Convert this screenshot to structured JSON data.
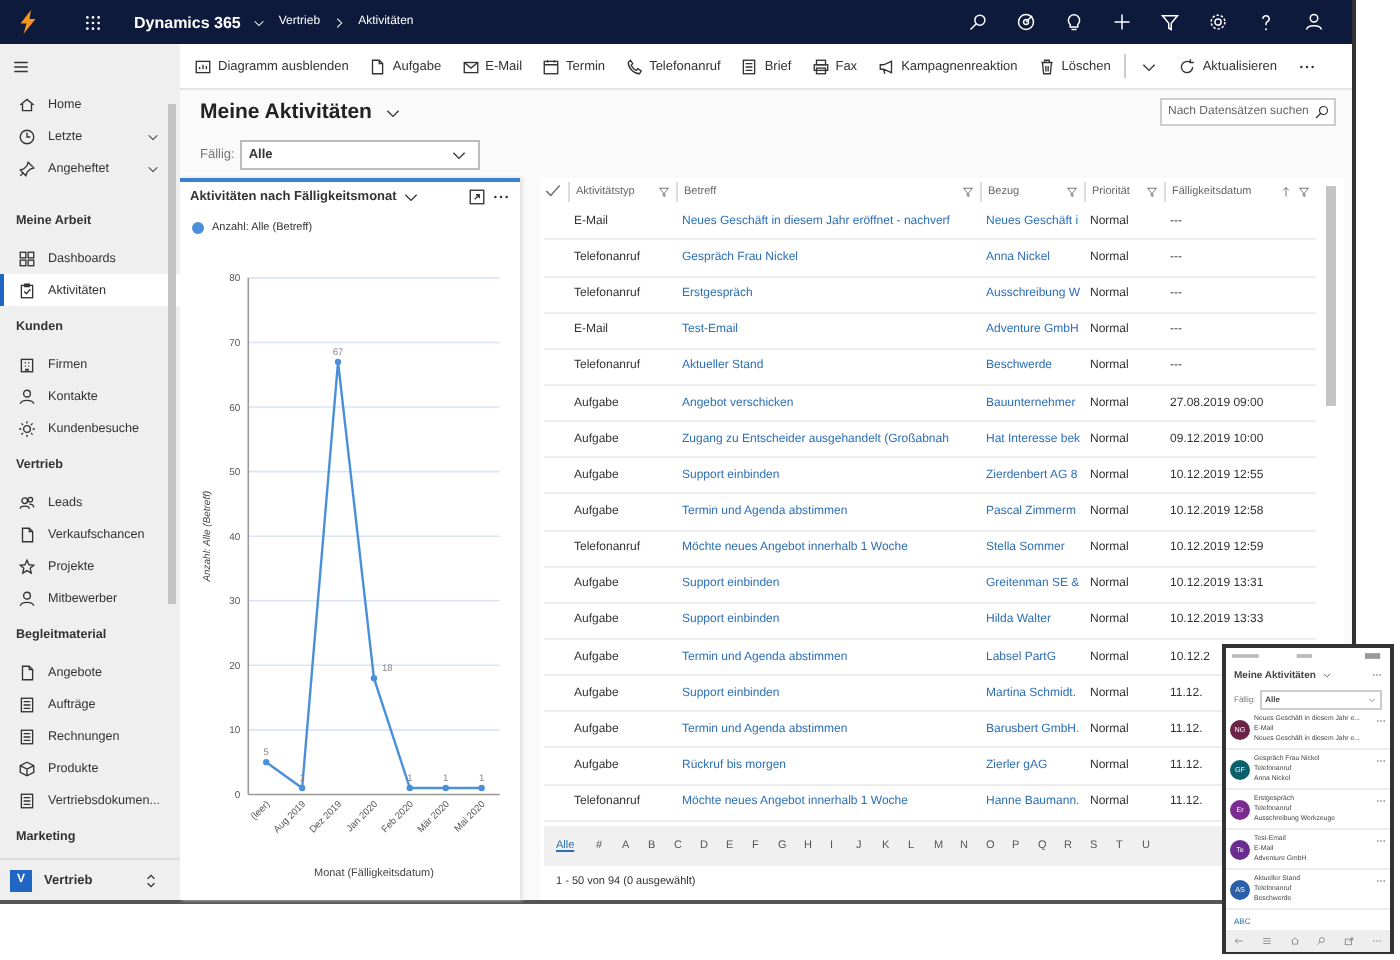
{
  "top_bar": {
    "app_name": "Dynamics 365",
    "breadcrumb": [
      "Vertrieb",
      "Aktivitäten"
    ]
  },
  "sidebar": {
    "items": [
      {
        "label": "Home",
        "selected": false
      },
      {
        "label": "Letzte",
        "selected": false,
        "expanded": false
      },
      {
        "label": "Angeheftet",
        "selected": false,
        "expanded": false
      }
    ],
    "sections": [
      {
        "title": "Meine Arbeit",
        "items": [
          {
            "label": "Dashboards",
            "selected": false
          },
          {
            "label": "Aktivitäten",
            "selected": true
          }
        ]
      },
      {
        "title": "Kunden",
        "items": [
          {
            "label": "Firmen",
            "selected": false
          },
          {
            "label": "Kontakte",
            "selected": false
          },
          {
            "label": "Kundenbesuche",
            "selected": false
          }
        ]
      },
      {
        "title": "Vertrieb",
        "items": [
          {
            "label": "Leads",
            "selected": false
          },
          {
            "label": "Verkaufschancen",
            "selected": false
          },
          {
            "label": "Projekte",
            "selected": false
          },
          {
            "label": "Mitbewerber",
            "selected": false
          }
        ]
      },
      {
        "title": "Begleitmaterial",
        "items": [
          {
            "label": "Angebote",
            "selected": false
          },
          {
            "label": "Aufträge",
            "selected": false
          },
          {
            "label": "Rechnungen",
            "selected": false
          },
          {
            "label": "Produkte",
            "selected": false
          },
          {
            "label": "Vertriebsdokumen...",
            "selected": false
          }
        ]
      },
      {
        "title": "Marketing"
      }
    ],
    "area": {
      "initial": "V",
      "label": "Vertrieb"
    }
  },
  "command_bar": [
    {
      "kind": "button",
      "label": "Diagramm ausblenden"
    },
    {
      "kind": "button",
      "label": "Aufgabe"
    },
    {
      "kind": "button",
      "label": "E-Mail"
    },
    {
      "kind": "button",
      "label": "Termin"
    },
    {
      "kind": "button",
      "label": "Telefonanruf"
    },
    {
      "kind": "button",
      "label": "Brief"
    },
    {
      "kind": "button",
      "label": "Fax"
    },
    {
      "kind": "button",
      "label": "Kampagnenreaktion"
    },
    {
      "kind": "button",
      "label": "Löschen"
    },
    {
      "kind": "dropdown"
    },
    {
      "kind": "button",
      "label": "Aktualisieren"
    },
    {
      "kind": "more"
    }
  ],
  "view": {
    "title": "Meine Aktivitäten",
    "filter": {
      "label": "Fällig:",
      "value": "Alle"
    },
    "search": {
      "placeholder": "Nach Datensätzen suchen"
    }
  },
  "chart_panel": {
    "chart_data": {
      "type": "line",
      "title": "Aktivitäten nach Fälligkeitsmonat",
      "xlabel": "Monat (Fälligkeitsdatum)",
      "ylabel": "Anzahl: Alle (Betreff)",
      "categories": [
        "(leer)",
        "Aug 2019",
        "Dez 2019",
        "Jan 2020",
        "Feb 2020",
        "Mär 2020",
        "Mai 2020"
      ],
      "series": [
        {
          "name": "Anzahl: Alle (Betreff)",
          "color": "#4a90d9",
          "marker": "circle",
          "values": [
            5,
            1,
            67,
            18,
            1,
            1,
            1
          ]
        }
      ],
      "ylim": [
        0,
        80
      ],
      "yticks": [
        0,
        10,
        20,
        30,
        40,
        50,
        60,
        70,
        80
      ],
      "grid": true,
      "data_labels": true
    }
  },
  "grid": {
    "columns": [
      {
        "label": "Aktivitätstyp",
        "sorted": false
      },
      {
        "label": "Betreff",
        "sorted": false
      },
      {
        "label": "Bezug",
        "sorted": false
      },
      {
        "label": "Priorität",
        "sorted": false
      },
      {
        "label": "Fälligkeitsdatum",
        "sorted": true
      }
    ],
    "rows": [
      [
        "E-Mail",
        "Neues Geschäft in diesem Jahr eröffnet - nachverf",
        "Neues Geschäft i",
        "Normal",
        "---"
      ],
      [
        "Telefonanruf",
        "Gespräch Frau Nickel",
        "Anna Nickel",
        "Normal",
        "---"
      ],
      [
        "Telefonanruf",
        "Erstgespräch",
        "Ausschreibung W",
        "Normal",
        "---"
      ],
      [
        "E-Mail",
        "Test-Email",
        "Adventure GmbH",
        "Normal",
        "---"
      ],
      [
        "Telefonanruf",
        "Aktueller Stand",
        "Beschwerde",
        "Normal",
        "---"
      ],
      [
        "Aufgabe",
        "Angebot verschicken",
        "Bauunternehmer",
        "Normal",
        "27.08.2019 09:00"
      ],
      [
        "Aufgabe",
        "Zugang zu Entscheider ausgehandelt (Großabnah",
        "Hat Interesse bek",
        "Normal",
        "09.12.2019 10:00"
      ],
      [
        "Aufgabe",
        "Support einbinden",
        "Zierdenbert AG 8",
        "Normal",
        "10.12.2019 12:55"
      ],
      [
        "Aufgabe",
        "Termin und Agenda abstimmen",
        "Pascal Zimmerm",
        "Normal",
        "10.12.2019 12:58"
      ],
      [
        "Telefonanruf",
        "Möchte neues Angebot innerhalb 1 Woche",
        "Stella Sommer",
        "Normal",
        "10.12.2019 12:59"
      ],
      [
        "Aufgabe",
        "Support einbinden",
        "Greitenman SE &",
        "Normal",
        "10.12.2019 13:31"
      ],
      [
        "Aufgabe",
        "Support einbinden",
        "Hilda Walter",
        "Normal",
        "10.12.2019 13:33"
      ],
      [
        "Aufgabe",
        "Termin und Agenda abstimmen",
        "Labsel PartG",
        "Normal",
        "10.12.2"
      ],
      [
        "Aufgabe",
        "Support einbinden",
        "Martina Schmidt.",
        "Normal",
        "11.12."
      ],
      [
        "Aufgabe",
        "Termin und Agenda abstimmen",
        "Barusbert GmbH.",
        "Normal",
        "11.12."
      ],
      [
        "Aufgabe",
        "Rückruf bis morgen",
        "Zierler gAG",
        "Normal",
        "11.12."
      ],
      [
        "Telefonanruf",
        "Möchte neues Angebot innerhalb 1 Woche",
        "Hanne Baumann.",
        "Normal",
        "11.12."
      ]
    ],
    "alphabet": [
      {
        "label": "Alle",
        "selected": true
      },
      {
        "label": "#",
        "selected": false
      },
      {
        "label": "A",
        "selected": false
      },
      {
        "label": "B",
        "selected": false
      },
      {
        "label": "C",
        "selected": false
      },
      {
        "label": "D",
        "selected": false
      },
      {
        "label": "E",
        "selected": false
      },
      {
        "label": "F",
        "selected": false
      },
      {
        "label": "G",
        "selected": false
      },
      {
        "label": "H",
        "selected": false
      },
      {
        "label": "I",
        "selected": false
      },
      {
        "label": "J",
        "selected": false
      },
      {
        "label": "K",
        "selected": false
      },
      {
        "label": "L",
        "selected": false
      },
      {
        "label": "M",
        "selected": false
      },
      {
        "label": "N",
        "selected": false
      },
      {
        "label": "O",
        "selected": false
      },
      {
        "label": "P",
        "selected": false
      },
      {
        "label": "Q",
        "selected": false
      },
      {
        "label": "R",
        "selected": false
      },
      {
        "label": "S",
        "selected": false
      },
      {
        "label": "T",
        "selected": false
      },
      {
        "label": "U",
        "selected": false
      }
    ],
    "record_count": "1 - 50 von 94 (0 ausgewählt)"
  },
  "mobile_preview": {
    "title": "Meine Aktivitäten",
    "filter": {
      "label": "Fällig:",
      "value": "Alle"
    },
    "items": [
      {
        "initials": "NG",
        "color": "#6b2346",
        "title": "Neues Geschäft in diesem Jahr e...",
        "type": "E-Mail",
        "regarding": "Neues Geschäft in diesem Jahr e..."
      },
      {
        "initials": "GF",
        "color": "#0b5f6b",
        "title": "Gespräch Frau Nickel",
        "type": "Telefonanruf",
        "regarding": "Anna Nickel"
      },
      {
        "initials": "Er",
        "color": "#7a2b8f",
        "title": "Erstgespräch",
        "type": "Telefonanruf",
        "regarding": "Ausschreibung Werkzeuge"
      },
      {
        "initials": "Te",
        "color": "#6a2c91",
        "title": "Test-Email",
        "type": "E-Mail",
        "regarding": "Adventure GmbH"
      },
      {
        "initials": "AS",
        "color": "#2b5fa8",
        "title": "Aktueller Stand",
        "type": "Telefonanruf",
        "regarding": "Beschwerde"
      }
    ],
    "footer_link": "ABC"
  }
}
